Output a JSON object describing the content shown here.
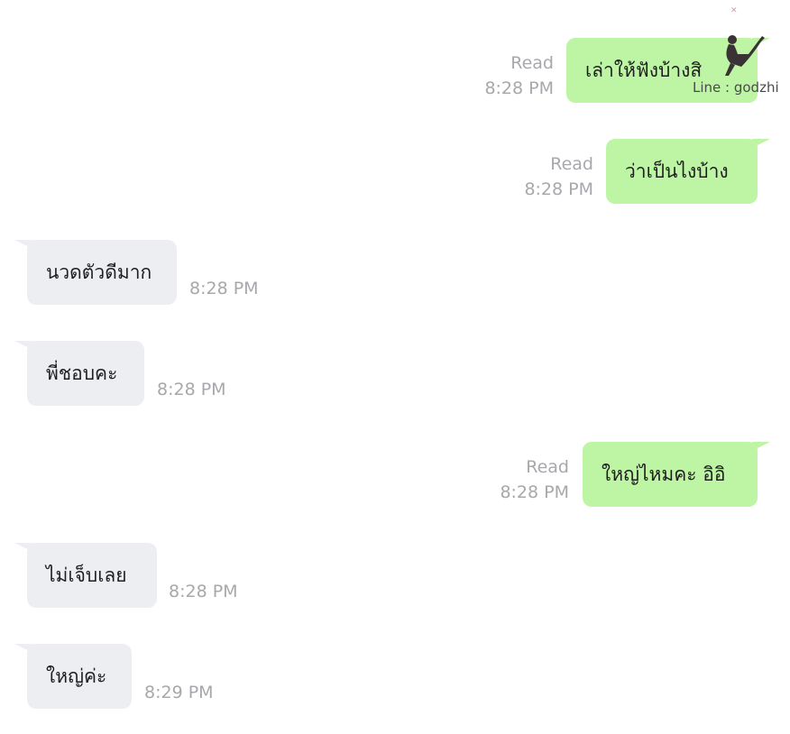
{
  "messages": [
    {
      "direction": "out",
      "text": "เล่าให้ฟังบ้างสิ",
      "status": "Read",
      "time": "8:28 PM"
    },
    {
      "direction": "out",
      "text": "ว่าเป็นไงบ้าง",
      "status": "Read",
      "time": "8:28 PM"
    },
    {
      "direction": "in",
      "text": "นวดตัวดีมาก",
      "time": "8:28 PM"
    },
    {
      "direction": "in",
      "text": "พี่ชอบคะ",
      "time": "8:28 PM"
    },
    {
      "direction": "out",
      "text": "ใหญ่ไหมคะ อิอิ",
      "status": "Read",
      "time": "8:28 PM"
    },
    {
      "direction": "in",
      "text": "ไม่เจ็บเลย",
      "time": "8:28 PM"
    },
    {
      "direction": "in",
      "text": "ใหญ่ค่ะ",
      "time": "8:29 PM"
    }
  ],
  "watermark": {
    "text": "Line : godzhi"
  },
  "colors": {
    "outgoing_bubble": "#bdf5a4",
    "incoming_bubble": "#edeef2",
    "meta_text": "#a7a8ad"
  }
}
